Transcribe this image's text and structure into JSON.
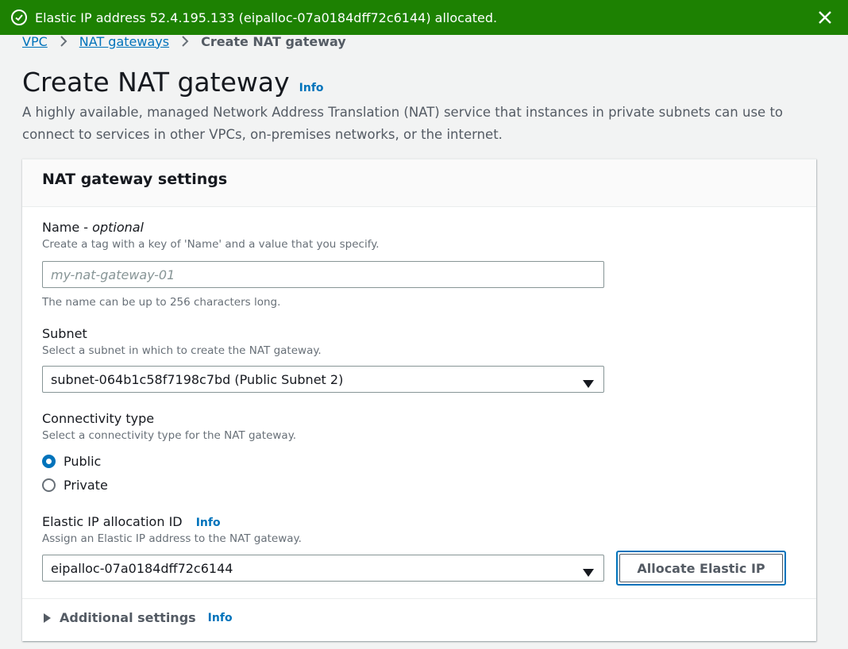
{
  "flash": {
    "message": "Elastic IP address 52.4.195.133 (eipalloc-07a0184dff72c6144) allocated.",
    "color": "#1d8102"
  },
  "breadcrumb": {
    "items": [
      "VPC",
      "NAT gateways"
    ],
    "current": "Create NAT gateway"
  },
  "page": {
    "title": "Create NAT gateway",
    "info": "Info",
    "description": "A highly available, managed Network Address Translation (NAT) service that instances in private subnets can use to connect to services in other VPCs, on-premises networks, or the internet."
  },
  "panel": {
    "title": "NAT gateway settings",
    "name": {
      "label": "Name",
      "optional": "optional",
      "hint": "Create a tag with a key of 'Name' and a value that you specify.",
      "placeholder": "my-nat-gateway-01",
      "value": "",
      "constraint": "The name can be up to 256 characters long."
    },
    "subnet": {
      "label": "Subnet",
      "hint": "Select a subnet in which to create the NAT gateway.",
      "value": "subnet-064b1c58f7198c7bd (Public Subnet 2)"
    },
    "connectivity": {
      "label": "Connectivity type",
      "hint": "Select a connectivity type for the NAT gateway.",
      "options": [
        "Public",
        "Private"
      ],
      "selected": "Public"
    },
    "eip": {
      "label": "Elastic IP allocation ID",
      "info": "Info",
      "hint": "Assign an Elastic IP address to the NAT gateway.",
      "value": "eipalloc-07a0184dff72c6144",
      "button": "Allocate Elastic IP"
    },
    "additional": {
      "label": "Additional settings",
      "info": "Info"
    }
  }
}
